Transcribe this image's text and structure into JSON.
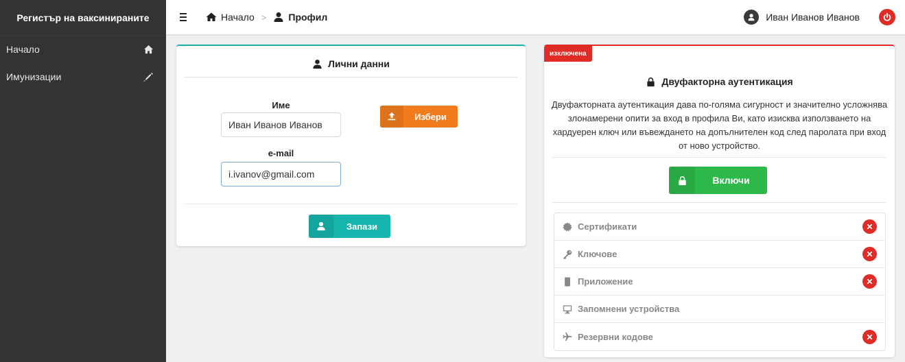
{
  "app": {
    "title": "Регистър на ваксинираните"
  },
  "sidebar": {
    "items": [
      {
        "label": "Начало",
        "icon": "home-icon"
      },
      {
        "label": "Имунизации",
        "icon": "syringe-icon"
      }
    ]
  },
  "topbar": {
    "breadcrumb": {
      "home": "Начало",
      "separator": ">",
      "current": "Профил"
    },
    "user_name": "Иван Иванов Иванов"
  },
  "personal": {
    "title": "Лични данни",
    "name_label": "Име",
    "name_value": "Иван Иванов Иванов",
    "email_label": "e-mail",
    "email_value": "i.ivanov@gmail.com",
    "upload_label": "Избери",
    "save_label": "Запази"
  },
  "twofa": {
    "status_badge": "изключена",
    "title": "Двуфакторна аутентикация",
    "description": "Двуфакторната аутентикация дава по-голяма сигурност и значително усложнява злонамерени опити за вход в профила Ви, като изисква използването на хардуерен ключ или въвеждането на допълнителен код след паролата при вход от ново устройство.",
    "enable_label": "Включи",
    "methods": [
      {
        "label": "Сертификати",
        "icon": "certificate-icon",
        "disabled": true
      },
      {
        "label": "Ключове",
        "icon": "key-icon",
        "disabled": true
      },
      {
        "label": "Приложение",
        "icon": "mobile-icon",
        "disabled": true
      },
      {
        "label": "Запомнени устройства",
        "icon": "desktop-icon",
        "disabled": false
      },
      {
        "label": "Резервни кодове",
        "icon": "plane-icon",
        "disabled": true
      }
    ]
  },
  "colors": {
    "sidebar_bg": "#333333",
    "teal": "#17b3ad",
    "orange": "#f07c1e",
    "green": "#2db84a",
    "red": "#e02b27"
  }
}
